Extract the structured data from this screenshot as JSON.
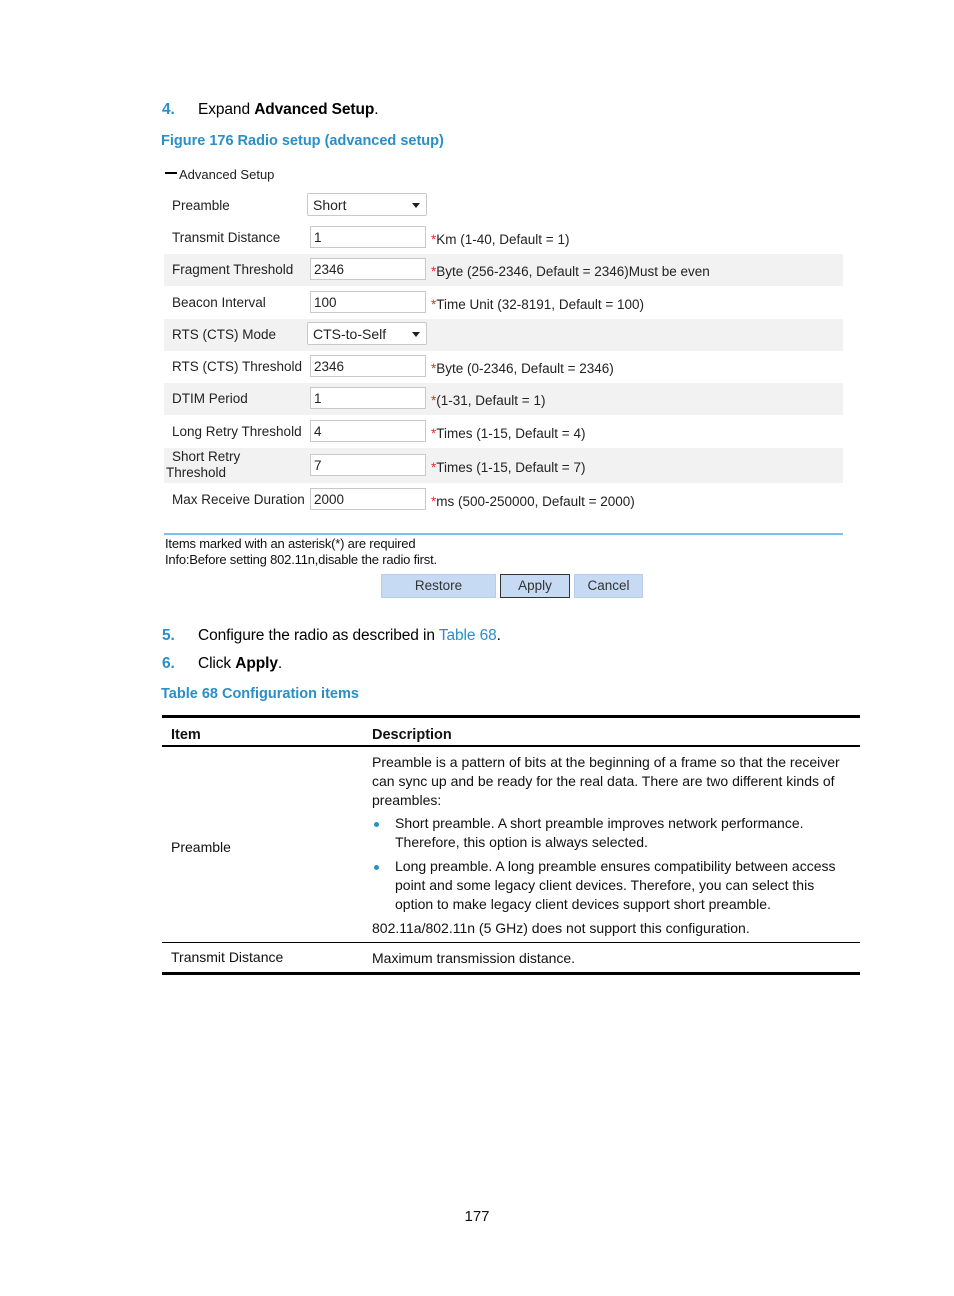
{
  "steps": {
    "step4": {
      "num": "4.",
      "text_before": "Expand ",
      "bold": "Advanced Setup",
      "text_after": "."
    },
    "step5": {
      "num": "5.",
      "text_before": "Configure the radio as described in ",
      "link": "Table 68",
      "text_after": "."
    },
    "step6": {
      "num": "6.",
      "text_before": "Click ",
      "bold": "Apply",
      "text_after": "."
    }
  },
  "figure_caption": "Figure 176 Radio setup (advanced setup)",
  "advanced_setup": {
    "section_title": "Advanced Setup",
    "collapse_icon": "minus-icon",
    "rows": [
      {
        "label": "Preamble",
        "type": "select",
        "value": "Short",
        "hint": ""
      },
      {
        "label": "Transmit Distance",
        "type": "input",
        "value": "1",
        "hint": "Km (1-40, Default = 1)"
      },
      {
        "label": "Fragment Threshold",
        "type": "input",
        "value": "2346",
        "hint": "Byte (256-2346, Default = 2346)Must be even"
      },
      {
        "label": "Beacon Interval",
        "type": "input",
        "value": "100",
        "hint": "Time Unit (32-8191, Default = 100)"
      },
      {
        "label": "RTS (CTS) Mode",
        "type": "select",
        "value": "CTS-to-Self",
        "hint": ""
      },
      {
        "label": "RTS (CTS) Threshold",
        "type": "input",
        "value": "2346",
        "hint": "Byte (0-2346, Default = 2346)"
      },
      {
        "label": "DTIM Period",
        "type": "input",
        "value": "1",
        "hint": "(1-31, Default = 1)"
      },
      {
        "label": "Long Retry Threshold",
        "type": "input",
        "value": "4",
        "hint": "Times (1-15, Default = 4)"
      },
      {
        "label": "Short Retry Threshold",
        "label_line1": "Short Retry",
        "label_line2": "Threshold",
        "type": "input",
        "value": "7",
        "hint": "Times (1-15, Default = 7)"
      },
      {
        "label": "Max Receive Duration",
        "type": "input",
        "value": "2000",
        "hint": "ms (500-250000, Default = 2000)"
      }
    ],
    "required_marker": "*",
    "note_required": "Items marked with an asterisk(*) are required",
    "note_info": "Info:Before setting 802.11n,disable the radio first.",
    "buttons": {
      "restore": "Restore",
      "apply": "Apply",
      "cancel": "Cancel"
    }
  },
  "table_caption": "Table 68 Configuration items",
  "config_table": {
    "headers": [
      "Item",
      "Description"
    ],
    "rows": [
      {
        "item": "Preamble",
        "intro": "Preamble is a pattern of bits at the beginning of a frame so that the receiver can sync up and be ready for the real data. There are two different kinds of preambles:",
        "bullets": [
          "Short preamble. A short preamble improves network performance. Therefore, this option is always selected.",
          "Long preamble. A long preamble ensures compatibility between access point and some legacy client devices. Therefore, you can select this option to make legacy client devices support short preamble."
        ],
        "note": "802.11a/802.11n (5 GHz) does not support this configuration."
      },
      {
        "item": "Transmit Distance",
        "intro": "Maximum transmission distance."
      }
    ]
  },
  "page_number": "177",
  "colors": {
    "accent": "#2a8fc7",
    "required": "#e03030",
    "button_bg": "#c6daf4",
    "row_shade": "#f2f2f2",
    "divider": "#7fc0e8"
  }
}
